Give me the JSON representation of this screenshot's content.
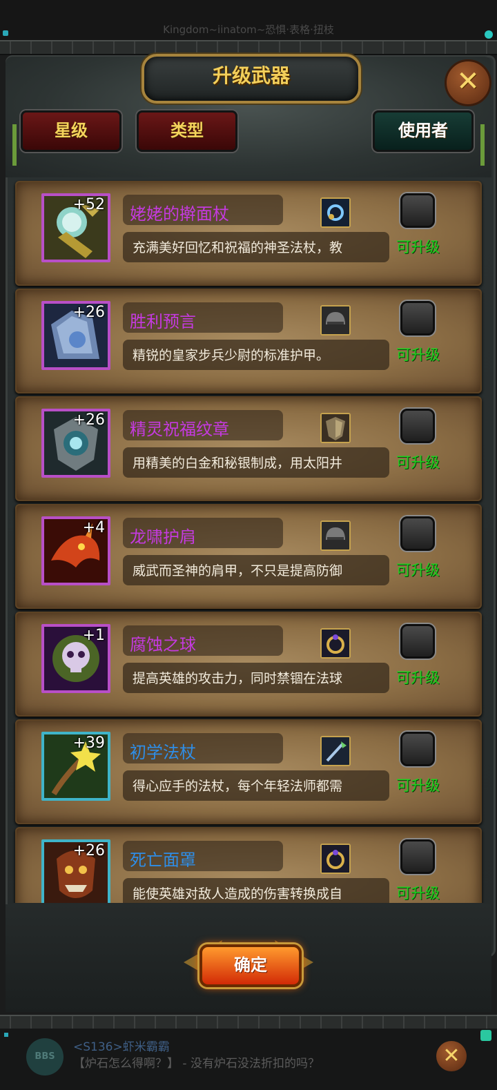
{
  "marquee": {
    "text": "Kingdom~iinatom~恐惧·表格·扭枝"
  },
  "header": {
    "title": "升级武器",
    "close_symbol": "✕"
  },
  "filters": [
    {
      "label": "星级"
    },
    {
      "label": "类型"
    },
    {
      "label": "使用者"
    }
  ],
  "items": [
    {
      "level": "+52",
      "name": "姥姥的擀面杖",
      "desc": "充满美好回忆和祝福的神圣法杖，教",
      "status": "可升级",
      "rarity_color": "#b84fc7",
      "type_icon": "amulet-icon"
    },
    {
      "level": "+26",
      "name": "胜利预言",
      "desc": "精锐的皇家步兵少尉的标准护甲。",
      "status": "可升级",
      "rarity_color": "#b84fc7",
      "type_icon": "helmet-icon"
    },
    {
      "level": "+26",
      "name": "精灵祝福纹章",
      "desc": "用精美的白金和秘银制成，用太阳井",
      "status": "可升级",
      "rarity_color": "#b84fc7",
      "type_icon": "shield-icon"
    },
    {
      "level": "+4",
      "name": "龙啸护肩",
      "desc": "威武而圣神的肩甲，不只是提高防御",
      "status": "可升级",
      "rarity_color": "#b84fc7",
      "type_icon": "helmet-icon"
    },
    {
      "level": "+1",
      "name": "腐蚀之球",
      "desc": "提高英雄的攻击力，同时禁锢在法球",
      "status": "可升级",
      "rarity_color": "#b84fc7",
      "type_icon": "ring-icon"
    },
    {
      "level": "+39",
      "name": "初学法杖",
      "desc": "得心应手的法杖，每个年轻法师都需",
      "status": "可升级",
      "rarity_color": "#3fb4c9",
      "type_icon": "staff-icon"
    },
    {
      "level": "+26",
      "name": "死亡面罩",
      "desc": "能使英雄对敌人造成的伤害转换成自",
      "status": "可升级",
      "rarity_color": "#3fb4c9",
      "type_icon": "ring-icon"
    }
  ],
  "confirm": {
    "label": "确定"
  },
  "chat": {
    "badge": "BBS",
    "line1": "<S136>虾米霸霸",
    "line2": "【炉石怎么得啊？】 - 没有炉石没法折扣的吗？",
    "close_symbol": "✕"
  }
}
